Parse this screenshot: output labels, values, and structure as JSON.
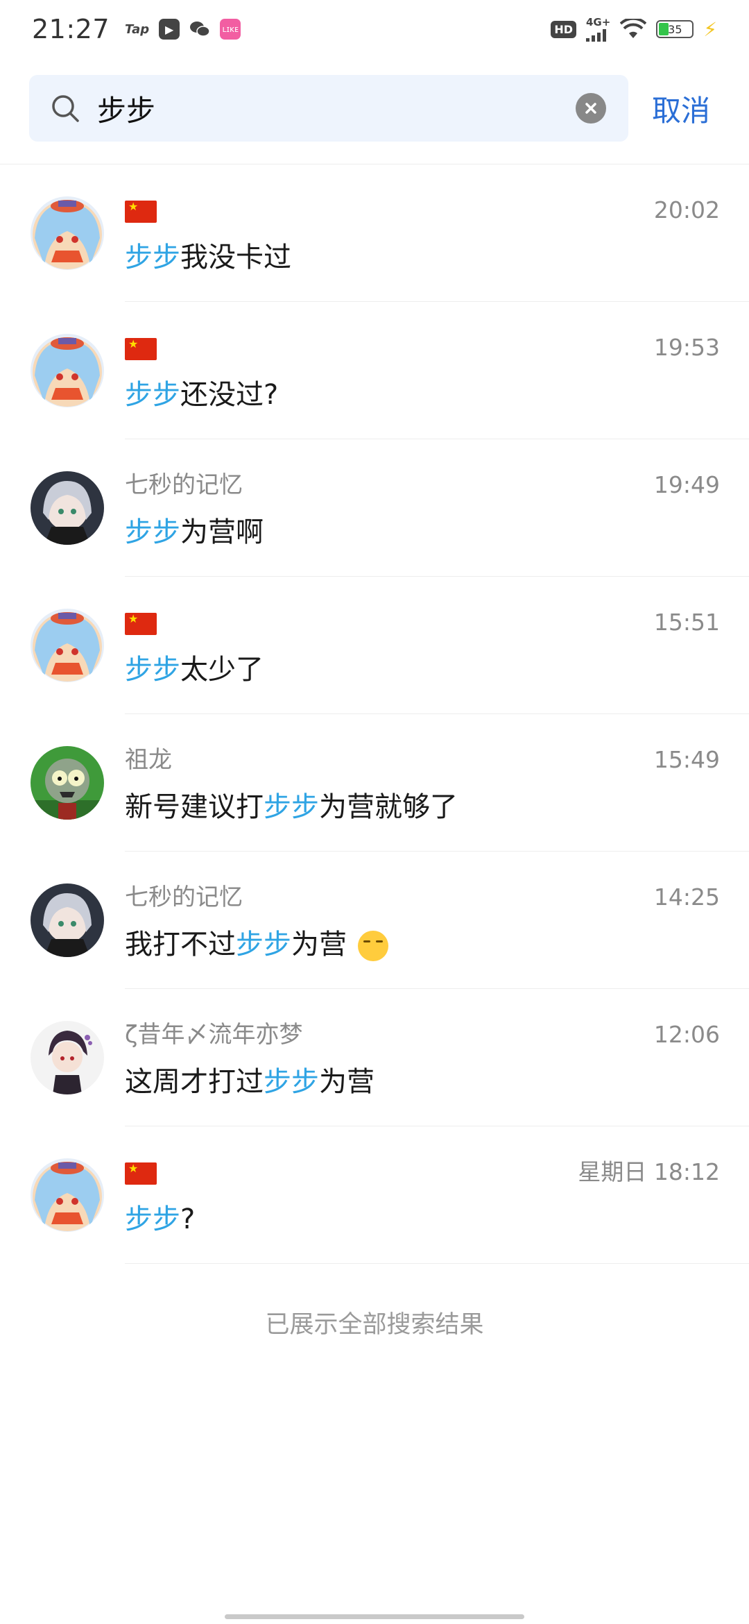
{
  "status_bar": {
    "time": "21:27",
    "tap_label": "Tap",
    "network": "4G+",
    "hd": "HD",
    "battery": "35"
  },
  "search": {
    "query": "步步",
    "cancel_label": "取消"
  },
  "results": [
    {
      "sender": "",
      "sender_flag": true,
      "time": "20:02",
      "highlight": "步步",
      "before": "",
      "after": "我没卡过",
      "avatar": "blue-hair"
    },
    {
      "sender": "",
      "sender_flag": true,
      "time": "19:53",
      "highlight": "步步",
      "before": "",
      "after": "还没过?",
      "avatar": "blue-hair"
    },
    {
      "sender": "七秒的记忆",
      "sender_flag": false,
      "time": "19:49",
      "highlight": "步步",
      "before": "",
      "after": "为营啊",
      "avatar": "silver-hair"
    },
    {
      "sender": "",
      "sender_flag": true,
      "time": "15:51",
      "highlight": "步步",
      "before": "",
      "after": "太少了",
      "avatar": "blue-hair"
    },
    {
      "sender": "祖龙",
      "sender_flag": false,
      "time": "15:49",
      "highlight": "步步",
      "before": "新号建议打",
      "after": "为营就够了",
      "avatar": "zombie"
    },
    {
      "sender": "七秒的记忆",
      "sender_flag": false,
      "time": "14:25",
      "highlight": "步步",
      "before": "我打不过",
      "after": "为营",
      "emoji": true,
      "avatar": "silver-hair"
    },
    {
      "sender": "ζ昔年〆流年亦梦",
      "sender_flag": false,
      "time": "12:06",
      "highlight": "步步",
      "before": "这周才打过",
      "after": "为营",
      "avatar": "dark-hair"
    },
    {
      "sender": "",
      "sender_flag": true,
      "time": "星期日 18:12",
      "highlight": "步步",
      "before": "",
      "after": "?",
      "avatar": "blue-hair"
    }
  ],
  "end_note": "已展示全部搜索结果"
}
